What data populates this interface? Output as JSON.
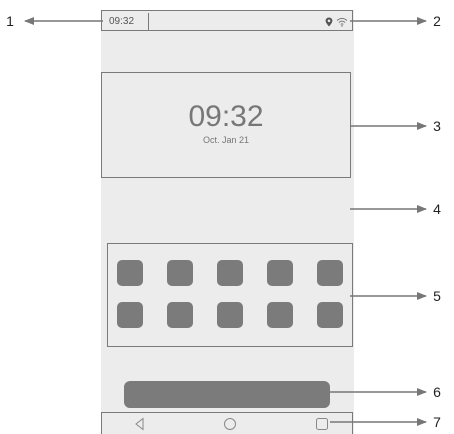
{
  "status_bar": {
    "time": "09:32",
    "icons": [
      "location-icon",
      "wifi-icon"
    ]
  },
  "clock_widget": {
    "time": "09:32",
    "date": "Oct. Jan 21"
  },
  "app_grid": {
    "rows": 2,
    "columns": 5
  },
  "nav_bar": {
    "buttons": [
      "back-icon",
      "home-icon",
      "recents-icon"
    ]
  },
  "callouts": [
    "1",
    "2",
    "3",
    "4",
    "5",
    "6",
    "7"
  ],
  "colors": {
    "screen": "#ececec",
    "outline": "#7a7a7a",
    "placeholder": "#7b7b7b",
    "arrow": "#777777"
  }
}
